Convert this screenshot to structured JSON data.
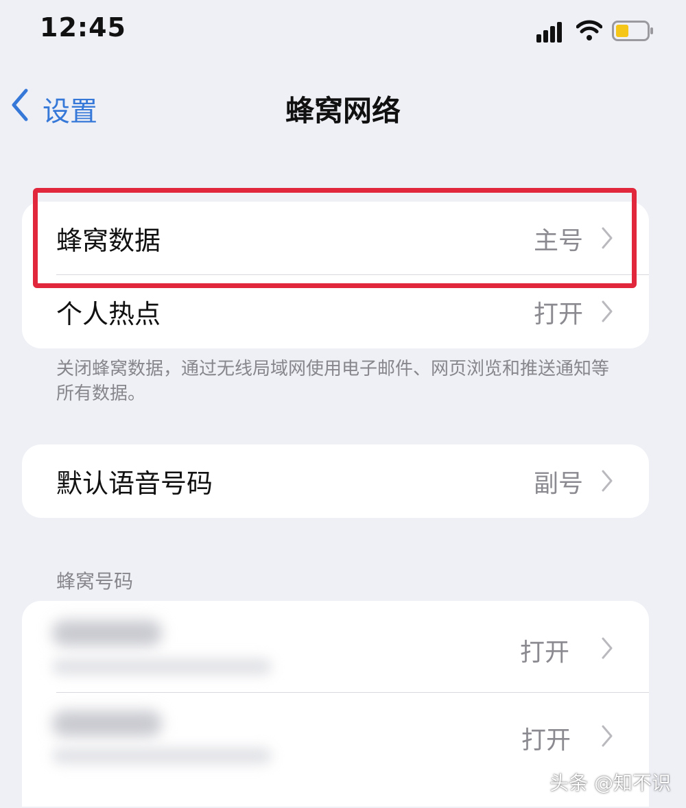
{
  "status_bar": {
    "time": "12:45",
    "icons": [
      "signal-icon",
      "wifi-icon",
      "battery-icon"
    ],
    "battery_color": "#f5c518"
  },
  "nav": {
    "back_label": "设置",
    "title": "蜂窝网络",
    "accent_color": "#3578d8"
  },
  "group1": {
    "rows": [
      {
        "label": "蜂窝数据",
        "value": "主号"
      },
      {
        "label": "个人热点",
        "value": "打开"
      }
    ]
  },
  "footnote": "关闭蜂窝数据，通过无线局域网使用电子邮件、网页浏览和推送通知等所有数据。",
  "group2": {
    "rows": [
      {
        "label": "默认语音号码",
        "value": "副号"
      }
    ]
  },
  "section_cellular_numbers": {
    "header": "蜂窝号码",
    "rows": [
      {
        "value": "打开"
      },
      {
        "value": "打开"
      }
    ]
  },
  "highlight_color": "#e0273c",
  "watermark": "头条 @知不识"
}
